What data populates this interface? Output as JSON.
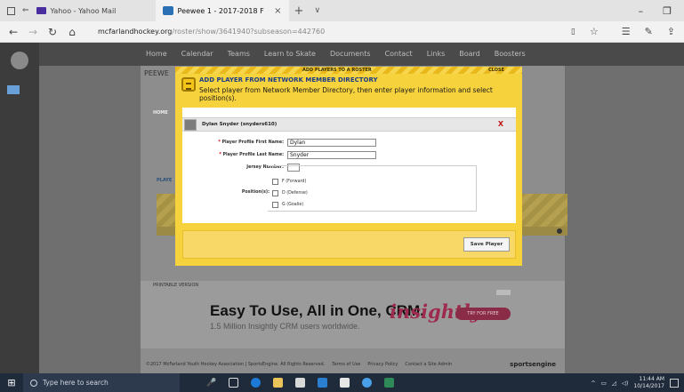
{
  "browser": {
    "tabs": [
      {
        "title": "Yahoo - Yahoo Mail",
        "active": false
      },
      {
        "title": "Peewee 1 - 2017-2018 F",
        "active": true
      }
    ],
    "new_tab_symbol": "+",
    "dropdown_symbol": "∨",
    "url_host": "mcfarlandhockey.org",
    "url_path": "/roster/show/3641940?subseason=442760"
  },
  "site": {
    "nav": [
      "Home",
      "Calendar",
      "Teams",
      "Learn to Skate",
      "Documents",
      "Contact",
      "Links",
      "Board",
      "Boosters"
    ],
    "team_title_fragment": "PEEWE",
    "home_tab": "HOME",
    "players_tab_fragment": "PLAYE",
    "printable_version": "PRINTABLE VERSION",
    "footer_text": "©2017 McFarland Youth Hockey Association | SportsEngine. All Rights Reserved.",
    "footer_links": [
      "Terms of Use",
      "Privacy Policy",
      "Contact a Site Admin"
    ],
    "footer_brand": "sportsengine"
  },
  "ad": {
    "headline": "Easy To Use, All in One, CRM.",
    "subline": "1.5 Million Insightly CRM users worldwide.",
    "brand": "insightly",
    "cta": "TRY FOR FREE"
  },
  "modal": {
    "top_title": "ADD PLAYERS TO A ROSTER",
    "close_label": "CLOSE",
    "heading": "ADD PLAYER FROM NETWORK MEMBER DIRECTORY",
    "instructions": "Select player from Network Member Directory, then enter player information and select position(s).",
    "member_name": "Dylan Snyder (snyders610)",
    "remove_symbol": "X",
    "fields": {
      "first_name_label": "Player Profile First Name:",
      "first_name_value": "Dylan",
      "last_name_label": "Player Profile Last Name:",
      "last_name_value": "Snyder",
      "jersey_label": "Jersey Number:",
      "jersey_value": "",
      "required_mark": "*"
    },
    "positions_label": "Position(s):",
    "positions": [
      "F (Forward)",
      "D (Defense)",
      "G (Goalie)"
    ],
    "save_label": "Save Player"
  },
  "taskbar": {
    "search_placeholder": "Type here to search",
    "time": "11:44 AM",
    "date": "10/14/2017"
  }
}
